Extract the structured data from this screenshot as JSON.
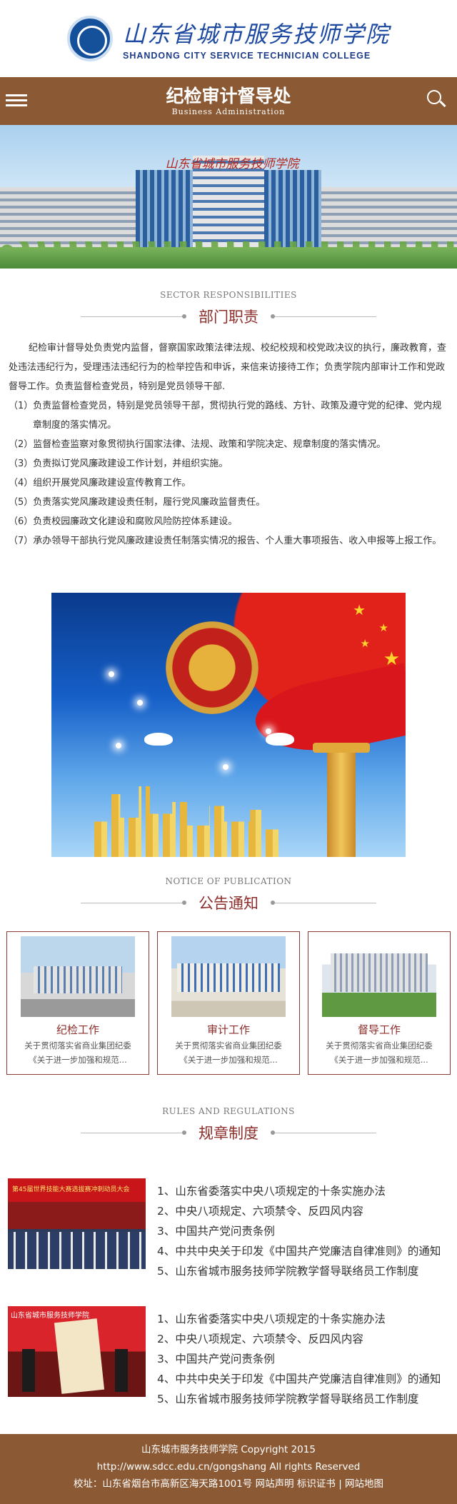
{
  "logo": {
    "cn": "山东省城市服务技师学院",
    "en": "SHANDONG CITY SERVICE TECHNICIAN COLLEGE"
  },
  "header": {
    "title_cn": "纪检审计督导处",
    "title_en": "Business Administration"
  },
  "banner": {
    "sign": "山东省城市服务技师学院"
  },
  "duties": {
    "heading_en": "SECTOR RESPONSIBILITIES",
    "heading_cn": "部门职责",
    "intro": "纪检审计督导处负责党内监督，督察国家政策法律法规、校纪校规和校党政决议的执行，廉政教育，查处违法违纪行为，受理违法违纪行为的检举控告和申诉，来信来访接待工作；负责学院内部审计工作和党政督导工作。负责监督检查党员，特别是党员领导干部.",
    "items": [
      "（1）负责监督检查党员，特别是党员领导干部，贯彻执行党的路线、方针、政策及遵守党的纪律、党内规章制度的落实情况。",
      "（2）监督检查监察对象贯彻执行国家法律、法规、政策和学院决定、规章制度的落实情况。",
      "（3）负责拟订党风廉政建设工作计划，并组织实施。",
      "（4）组织开展党风廉政建设宣传教育工作。",
      "（5）负责落实党风廉政建设责任制，履行党风廉政监督责任。",
      "（6）负责校园廉政文化建设和腐败风险防控体系建设。",
      "（7）承办领导干部执行党风廉政建设责任制落实情况的报告、个人重大事项报告、收入申报等上报工作。"
    ]
  },
  "notice": {
    "heading_en": "NOTICE OF PUBLICATION",
    "heading_cn": "公告通知",
    "cards": [
      {
        "title": "纪检工作",
        "desc1": "关于贯彻落实省商业集团纪委",
        "desc2": "《关于进一步加强和规范..."
      },
      {
        "title": "审计工作",
        "desc1": "关于贯彻落实省商业集团纪委",
        "desc2": "《关于进一步加强和规范..."
      },
      {
        "title": "督导工作",
        "desc1": "关于贯彻落实省商业集团纪委",
        "desc2": "《关于进一步加强和规范..."
      }
    ]
  },
  "rules": {
    "heading_en": "RULES AND REGULATIONS",
    "heading_cn": "规章制度",
    "block1": [
      "1、山东省委落实中央八项规定的十条实施办法",
      "2、中央八项规定、六项禁令、反四风内容",
      "3、中国共产党问责条例",
      "4、中共中央关于印发《中国共产党廉洁自律准则》的通知",
      "5、山东省城市服务技师学院教学督导联络员工作制度"
    ],
    "block2": [
      "1、山东省委落实中央八项规定的十条实施办法",
      "2、中央八项规定、六项禁令、反四风内容",
      "3、中国共产党问责条例",
      "4、中共中央关于印发《中国共产党廉洁自律准则》的通知",
      "5、山东省城市服务技师学院教学督导联络员工作制度"
    ],
    "img1_caption": "第45届世界技能大赛选拔赛冲刺动员大会",
    "img2_caption": "山东省城市服务技师学院"
  },
  "footer": {
    "line1": "山东城市服务技师学院 Copyright 2015",
    "line2": "http://www.sdcc.edu.cn/gongshang All rights Reserved",
    "address": "校址：山东省烟台市高新区海天路1001号",
    "link_statement": "网站声明",
    "link_cert": "标识证书",
    "sep": "|",
    "link_sitemap": "网站地图"
  },
  "colors": {
    "brown": "#8b5a35",
    "accent_red": "#8b2d2a",
    "logo_blue": "#1d4aa0"
  }
}
